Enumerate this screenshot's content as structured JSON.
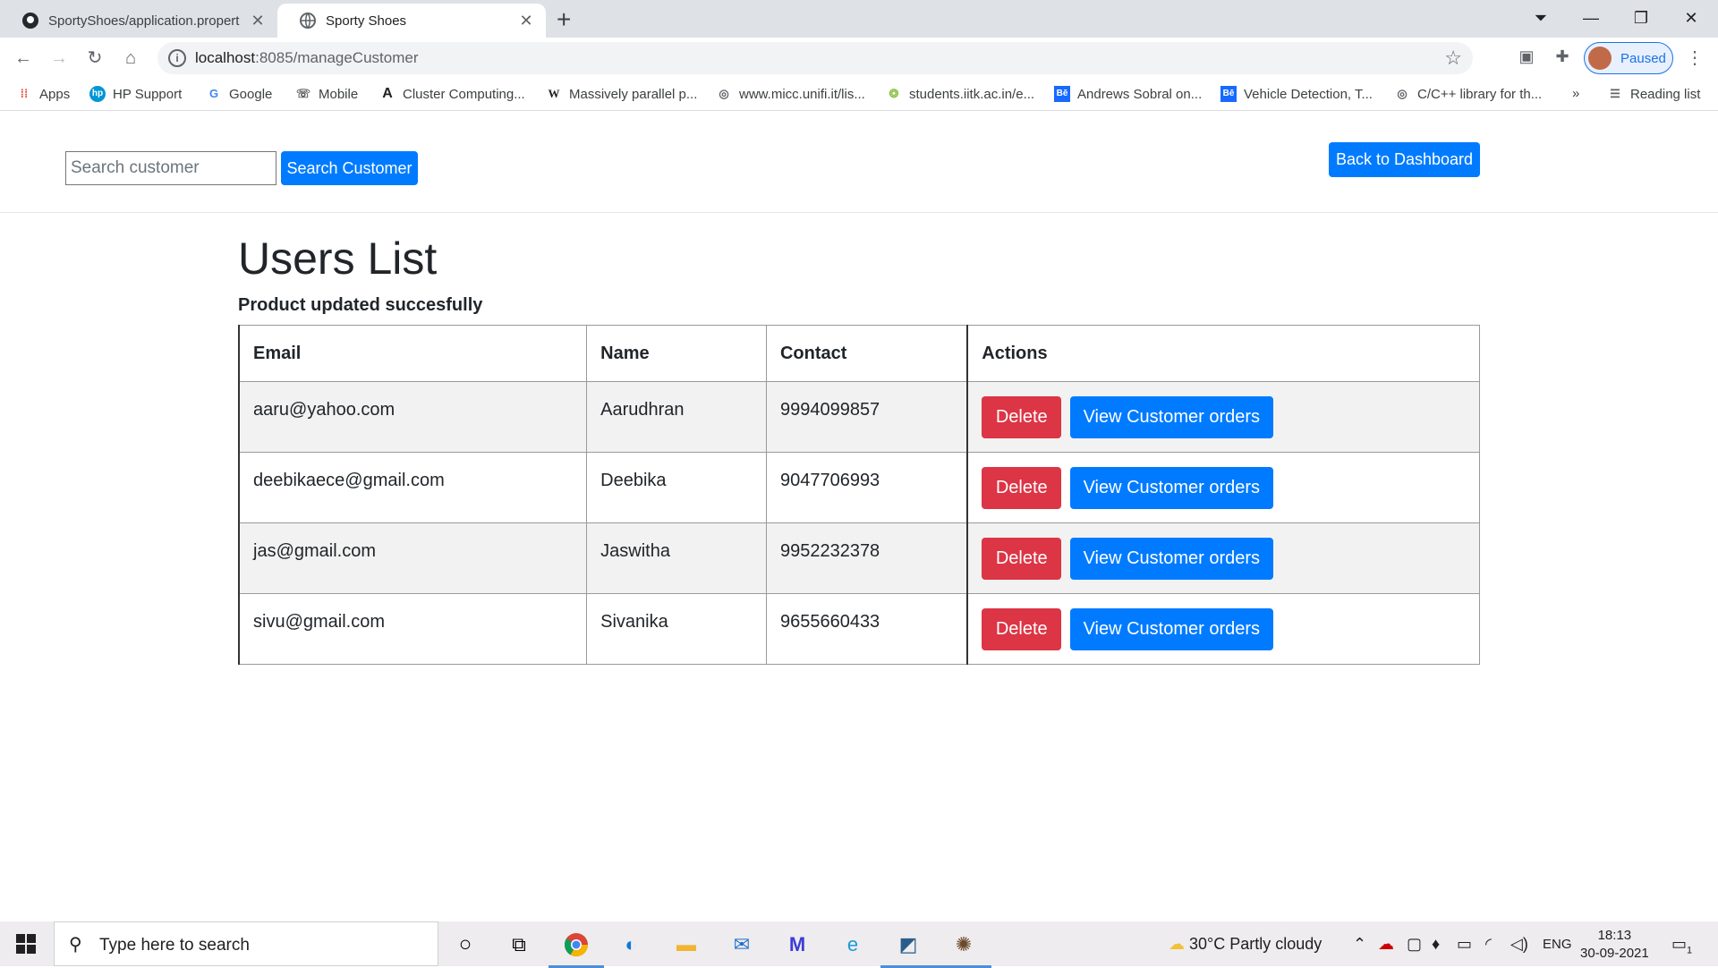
{
  "browser": {
    "tabs": [
      {
        "title": "SportyShoes/application.propert",
        "active": false
      },
      {
        "title": "Sporty Shoes",
        "active": true
      }
    ],
    "address": {
      "host": "localhost",
      "path": ":8085/manageCustomer"
    },
    "profile_label": "Paused",
    "bookmarks": [
      {
        "label": "Apps",
        "icon": "apps-grid-icon"
      },
      {
        "label": "HP Support",
        "icon": "hp-icon"
      },
      {
        "label": "Google",
        "icon": "google-icon"
      },
      {
        "label": "Mobile",
        "icon": "mobile-icon"
      },
      {
        "label": "Cluster Computing...",
        "icon": "a-icon"
      },
      {
        "label": "Massively parallel p...",
        "icon": "wikipedia-icon"
      },
      {
        "label": "www.micc.unifi.it/lis...",
        "icon": "globe-icon"
      },
      {
        "label": "students.iitk.ac.in/e...",
        "icon": "iitk-icon"
      },
      {
        "label": "Andrews Sobral on...",
        "icon": "behance-icon"
      },
      {
        "label": "Vehicle Detection, T...",
        "icon": "behance-icon"
      },
      {
        "label": "C/C++ library for th...",
        "icon": "globe-icon"
      }
    ],
    "overflow": "»",
    "reading_list": "Reading list"
  },
  "page": {
    "search": {
      "placeholder": "Search customer",
      "value": "",
      "button": "Search Customer"
    },
    "dashboard_button": "Back to Dashboard",
    "title": "Users List",
    "message": "Product updated succesfully",
    "table": {
      "headers": [
        "Email",
        "Name",
        "Contact",
        "Actions"
      ],
      "rows": [
        {
          "email": "aaru@yahoo.com",
          "name": "Aarudhran",
          "contact": "9994099857"
        },
        {
          "email": "deebikaece@gmail.com",
          "name": "Deebika",
          "contact": "9047706993"
        },
        {
          "email": "jas@gmail.com",
          "name": "Jaswitha",
          "contact": "9952232378"
        },
        {
          "email": "sivu@gmail.com",
          "name": "Sivanika",
          "contact": "9655660433"
        }
      ],
      "delete_label": "Delete",
      "view_label": "View Customer orders"
    }
  },
  "taskbar": {
    "search_placeholder": "Type here to search",
    "weather": "30°C  Partly cloudy",
    "lang": "ENG",
    "time": "18:13",
    "date": "30-09-2021",
    "notifications": "1"
  },
  "colors": {
    "primary": "#007bff",
    "danger": "#dc3545",
    "stripe": "#f2f2f2"
  }
}
